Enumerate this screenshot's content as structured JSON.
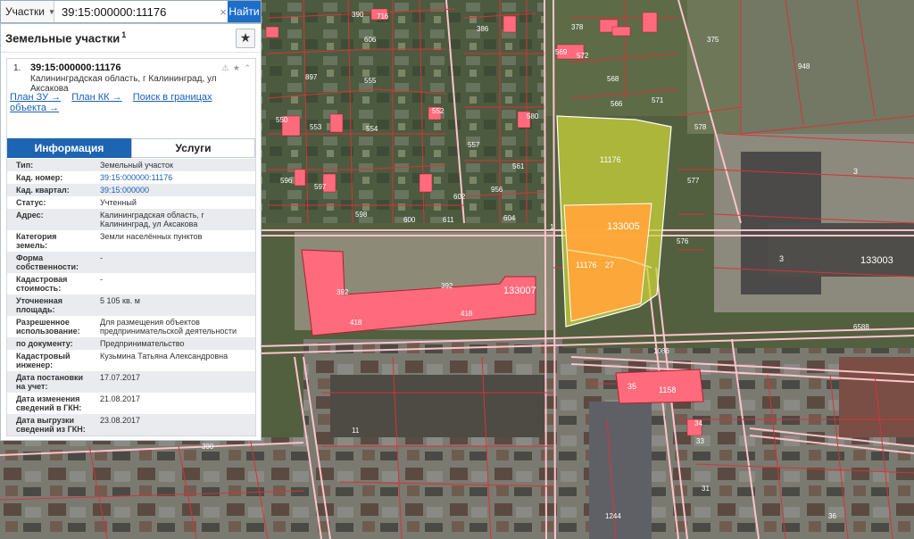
{
  "search": {
    "type_label": "Участки",
    "query": "39:15:000000:11176",
    "button_label": "Найти"
  },
  "panel": {
    "title": "Земельные участки",
    "title_count": "1",
    "card": {
      "index": "1.",
      "number": "39:15:000000:11176",
      "address": "Калининградская область, г Калининград, ул Аксакова",
      "links": {
        "plan_zu": "План ЗУ →",
        "plan_kk": "План КК →",
        "search_bounds": "Поиск в границах объекта →"
      }
    },
    "tabs": {
      "info": "Информация",
      "services": "Услуги"
    },
    "rows": [
      {
        "key": "Тип:",
        "value": "Земельный участок"
      },
      {
        "key": "Кад. номер:",
        "value": "39:15:000000:11176"
      },
      {
        "key": "Кад. квартал:",
        "value": "39:15:000000"
      },
      {
        "key": "Статус:",
        "value": "Учтенный"
      },
      {
        "key": "Адрес:",
        "value": "Калининградская область, г Калининград, ул Аксакова"
      },
      {
        "key": "Категория земель:",
        "value": "Земли населённых пунктов"
      },
      {
        "key": "Форма собственности:",
        "value": "-"
      },
      {
        "key": "Кадастровая стоимость:",
        "value": "-"
      },
      {
        "key": "Уточненная площадь:",
        "value": "5 105 кв. м"
      },
      {
        "key": "Разрешенное использование:",
        "value": "Для размещения объектов предпринимательской деятельности"
      },
      {
        "key": "по документу:",
        "value": "Предпринимательство"
      },
      {
        "key": "Кадастровый инженер:",
        "value": "Кузьмина Татьяна Александровна"
      },
      {
        "key": "Дата постановки на учет:",
        "value": "17.07.2017"
      },
      {
        "key": "Дата изменения сведений в ГКН:",
        "value": "21.08.2017"
      },
      {
        "key": "Дата выгрузки сведений из ГКН:",
        "value": "23.08.2017"
      }
    ]
  },
  "map": {
    "selected_parcel_label": "11176",
    "selected_building_label": "133005",
    "selected_inner_labels": [
      "11176",
      "27"
    ],
    "building_labels": [
      {
        "id": "b133007",
        "text": "133007"
      },
      {
        "id": "b392a",
        "text": "392"
      },
      {
        "id": "b392b",
        "text": "392"
      },
      {
        "id": "b418a",
        "text": "418"
      },
      {
        "id": "b418b",
        "text": "418"
      },
      {
        "id": "b35",
        "text": "35"
      },
      {
        "id": "b1158",
        "text": "1158"
      },
      {
        "id": "b133003",
        "text": "133003"
      },
      {
        "id": "b3",
        "text": "3"
      },
      {
        "id": "b3b",
        "text": "3"
      },
      {
        "id": "b1086",
        "text": "1086"
      },
      {
        "id": "b6588",
        "text": "6588"
      }
    ],
    "plot_labels": [
      "390",
      "716",
      "386",
      "378",
      "375",
      "948",
      "606",
      "555",
      "553",
      "554",
      "550",
      "897",
      "557",
      "566",
      "571",
      "578",
      "561",
      "577",
      "576",
      "596",
      "597",
      "598",
      "602",
      "956",
      "600",
      "611",
      "604",
      "1",
      "11",
      "34",
      "33",
      "31",
      "1244",
      "36",
      "390",
      "569",
      "572",
      "568",
      "580",
      "552"
    ],
    "colors": {
      "selected_parcel": "#c9d33b",
      "selected_building": "#ffa73a",
      "buildings": "#ff6b7d",
      "plot_lines": "#d8323c",
      "roads": "#ffc8d0"
    }
  }
}
